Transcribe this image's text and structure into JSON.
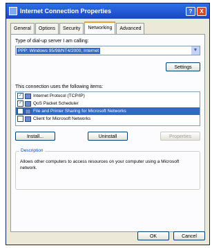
{
  "window": {
    "title": "Internet Connection Properties",
    "help": "?",
    "close": "X"
  },
  "tabs": [
    {
      "label": "General"
    },
    {
      "label": "Options"
    },
    {
      "label": "Security"
    },
    {
      "label": "Networking"
    },
    {
      "label": "Advanced"
    }
  ],
  "active_tab": "Networking",
  "dialup": {
    "label": "Type of dial-up server I am calling:",
    "selected": "PPP: Windows 95/98/NT4/2000, Internet",
    "arrow": "▼",
    "settings_label": "Settings"
  },
  "components": {
    "label": "This connection uses the following items:",
    "items": [
      {
        "label": "Internet Protocol (TCP/IP)",
        "checked": true,
        "mark": "✓"
      },
      {
        "label": "QoS Packet Scheduler",
        "checked": true,
        "mark": "✓"
      },
      {
        "label": "File and Printer Sharing for Microsoft Networks",
        "checked": false,
        "mark": ""
      },
      {
        "label": "Client for Microsoft Networks",
        "checked": false,
        "mark": ""
      }
    ]
  },
  "actions": {
    "install": "Install...",
    "uninstall": "Uninstall",
    "properties": "Properties"
  },
  "description": {
    "title": "Description",
    "text": "Allows other computers to access resources on your computer using a Microsoft network."
  },
  "footer": {
    "ok": "OK",
    "cancel": "Cancel"
  }
}
